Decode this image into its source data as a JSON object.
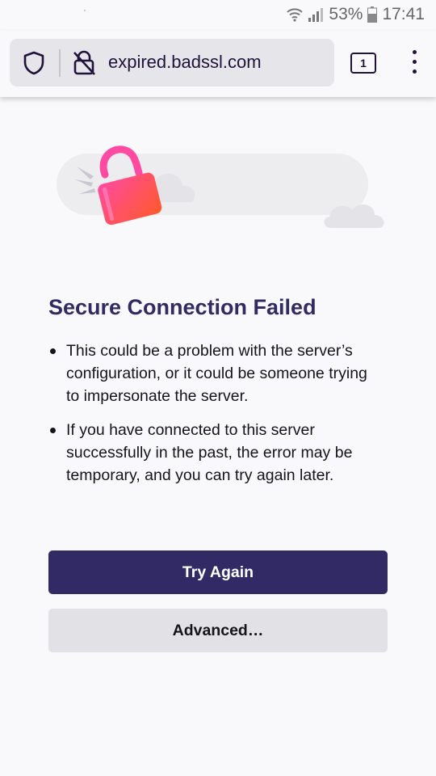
{
  "status_bar": {
    "battery": "53%",
    "time": "17:41",
    "icons": [
      "wifi-icon",
      "signal-icon",
      "battery-icon"
    ]
  },
  "toolbar": {
    "url": "expired.badssl.com",
    "tab_count": "1",
    "icons": [
      "shield-icon",
      "broken-lock-icon",
      "overflow-menu-icon"
    ]
  },
  "error_page": {
    "title": "Secure Connection Failed",
    "bullets": [
      "This could be a problem with the server’s configuration, or it could be someone trying to impersonate the server.",
      "If you have connected to this server successfully in the past, the error may be temporary, and you can try again later."
    ],
    "try_again_label": "Try Again",
    "advanced_label": "Advanced…"
  },
  "colors": {
    "background": "#f9f9fb",
    "title": "#312a65",
    "primary_button": "#312a65",
    "secondary_button": "#e2e1e6",
    "lock_gradient_start": "#ff4aa2",
    "lock_gradient_end": "#ff5a2a"
  }
}
